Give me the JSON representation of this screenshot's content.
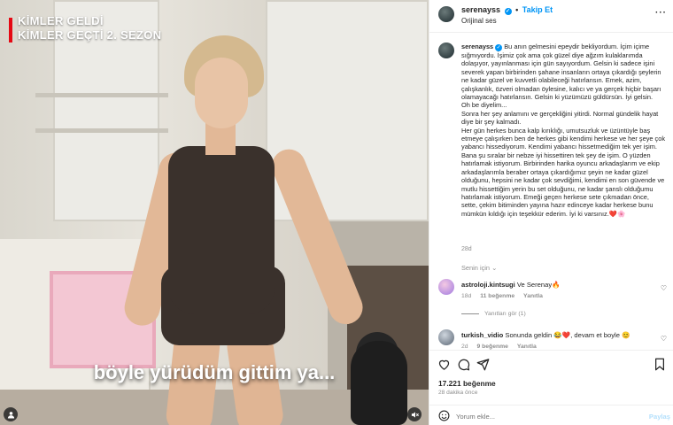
{
  "media": {
    "title_line1": "KİMLER GELDİ",
    "title_line2": "KİMLER GEÇTİ 2. SEZON",
    "subtitle": "böyle yürüdüm gittim ya...",
    "accent_color": "#e50914",
    "user_icon": "user-tag-icon",
    "mute_icon": "mute-icon"
  },
  "header": {
    "username": "serenayss",
    "follow_label": "Takip Et",
    "audio_label": "Orijinal ses",
    "verified_color": "#0095f6"
  },
  "caption": {
    "username": "serenayss",
    "text": "Bu anın gelmesini epeydir bekliyordum. İçim içime sığmıyordu. İşimiz çok ama çok güzel diye ağzım kulaklarımda dolaşıyor, yayınlanması için gün sayıyordum. Gelsin ki sadece işini severek yapan birbirinden şahane insanların ortaya çıkardığı şeylerin ne kadar güzel ve kuvvetli olabileceği hatırlansın. Emek, azim, çalışkanlık, özveri olmadan öylesine, kalıcı ve ya gerçek hiçbir başarı olamayacağı hatırlansın. Gelsin ki yüzümüzü güldürsün. İyi gelsin.\nOh be diyelim...\nSonra her şey anlamını ve gerçekliğini yitirdi. Normal gündelik hayat diye bir şey kalmadı.\nHer gün herkes bunca kalp kırıklığı, umutsuzluk ve üzüntüyle baş etmeye çalışırken ben de herkes gibi kendimi herkese ve her şeye çok yabancı hissediyorum. Kendimi yabancı hissetmediğim tek yer işim. Bana şu sıralar bir nebze iyi hissettiren tek şey de işim. O yüzden hatırlamak istiyorum. Birbirinden harika oyuncu arkadaşlarım ve ekip arkadaşlarımla beraber ortaya çıkardığımız şeyin ne kadar güzel olduğunu, hepsini ne kadar çok sevdiğimi, kendimi en son güvende ve mutlu hissettiğim yerin bu set olduğunu, ne kadar şanslı olduğumu hatırlamak istiyorum. Emeği geçen herkese sete çıkmadan önce, sette, çekim bitiminden yayına hazır edinceye kadar herkese bunu mümkün kıldığı için teşekkür ederim. İyi ki varsınız.❤️🌸",
    "date": "28d"
  },
  "original_label": "Senin için ⌄",
  "comments": [
    {
      "username": "astroloji.kintsugi",
      "text": "Ve Serenay🔥",
      "age": "18d",
      "likes": "11 beğenme",
      "reply": "Yanıtla"
    },
    {
      "username": "turkish_vidio",
      "text": "Sonunda geldin 😂❤️, devam et boyle 😊",
      "age": "2d",
      "likes": "9 beğenme",
      "reply": "Yanıtla"
    }
  ],
  "replies_label": "Yanıtları gör (1)",
  "actions": {
    "like_icon": "heart-icon",
    "comment_icon": "comment-icon",
    "share_icon": "share-icon",
    "save_icon": "bookmark-icon",
    "likes_count": "17.221 beğenme",
    "time_ago": "28 dakika önce"
  },
  "comment_input": {
    "placeholder": "Yorum ekle...",
    "post_label": "Paylaş",
    "emoji_icon": "emoji-icon"
  }
}
